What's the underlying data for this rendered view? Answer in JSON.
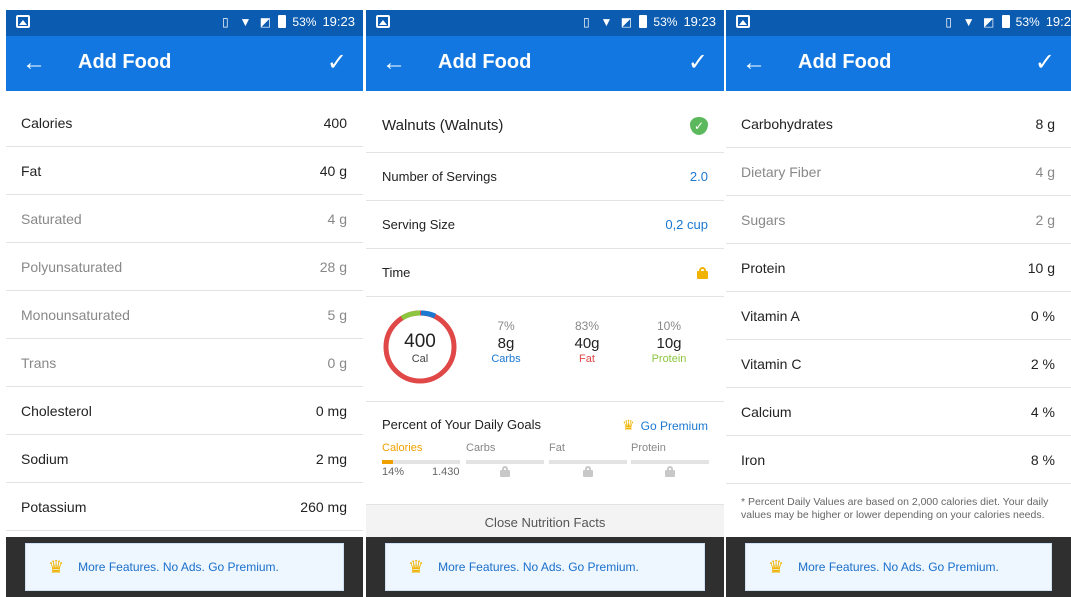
{
  "statusbar": {
    "battery": "53%",
    "time": "19:23",
    "time_cut": "19:2"
  },
  "appbar": {
    "title": "Add Food",
    "back_icon": "←",
    "confirm_icon": "✓"
  },
  "panel1": {
    "rows": [
      {
        "label": "Calories",
        "value": "400",
        "sub": false
      },
      {
        "label": "Fat",
        "value": "40 g",
        "sub": false
      },
      {
        "label": "Saturated",
        "value": "4 g",
        "sub": true
      },
      {
        "label": "Polyunsaturated",
        "value": "28 g",
        "sub": true
      },
      {
        "label": "Monounsaturated",
        "value": "5 g",
        "sub": true
      },
      {
        "label": "Trans",
        "value": "0 g",
        "sub": true
      },
      {
        "label": "Cholesterol",
        "value": "0 mg",
        "sub": false
      },
      {
        "label": "Sodium",
        "value": "2 mg",
        "sub": false
      },
      {
        "label": "Potassium",
        "value": "260 mg",
        "sub": false
      }
    ]
  },
  "panel2": {
    "food_name": "Walnuts (Walnuts)",
    "servings_label": "Number of Servings",
    "servings_value": "2.0",
    "serving_size_label": "Serving Size",
    "serving_size_value": "0,2 cup",
    "time_label": "Time",
    "ring": {
      "value": "400",
      "unit": "Cal"
    },
    "macros": [
      {
        "pct": "7%",
        "grams": "8g",
        "name": "Carbs",
        "color": "#1a78d0"
      },
      {
        "pct": "83%",
        "grams": "40g",
        "name": "Fat",
        "color": "#e04848"
      },
      {
        "pct": "10%",
        "grams": "10g",
        "name": "Protein",
        "color": "#8cc63f"
      }
    ],
    "goals": {
      "title": "Percent of Your Daily Goals",
      "premium": "Go Premium",
      "columns": [
        "Calories",
        "Carbs",
        "Fat",
        "Protein"
      ],
      "calories_pct": "14%",
      "calories_goal": "1.430",
      "calories_progress": 0.14
    },
    "close": "Close Nutrition Facts"
  },
  "panel3": {
    "rows": [
      {
        "label": "Carbohydrates",
        "value": "8 g",
        "sub": false
      },
      {
        "label": "Dietary Fiber",
        "value": "4 g",
        "sub": true
      },
      {
        "label": "Sugars",
        "value": "2 g",
        "sub": true
      },
      {
        "label": "Protein",
        "value": "10 g",
        "sub": false
      },
      {
        "label": "Vitamin A",
        "value": "0 %",
        "sub": false
      },
      {
        "label": "Vitamin C",
        "value": "2 %",
        "sub": false
      },
      {
        "label": "Calcium",
        "value": "4 %",
        "sub": false
      },
      {
        "label": "Iron",
        "value": "8 %",
        "sub": false
      }
    ],
    "footnote": "* Percent Daily Values are based on 2,000 calories diet. Your daily values may be higher or lower depending on your calories needs."
  },
  "promo": {
    "text": "More Features. No Ads. Go Premium."
  },
  "colors": {
    "statusbar": "#0b5bb0",
    "appbar": "#1277e0",
    "accent": "#1a78d0",
    "gold": "#f0b400"
  },
  "icons": [
    "notification-icon",
    "vibrate-icon",
    "wifi-icon",
    "no-sim-icon",
    "battery-icon",
    "back-arrow-icon",
    "check-icon",
    "verified-shield-icon",
    "lock-icon",
    "crown-icon"
  ]
}
